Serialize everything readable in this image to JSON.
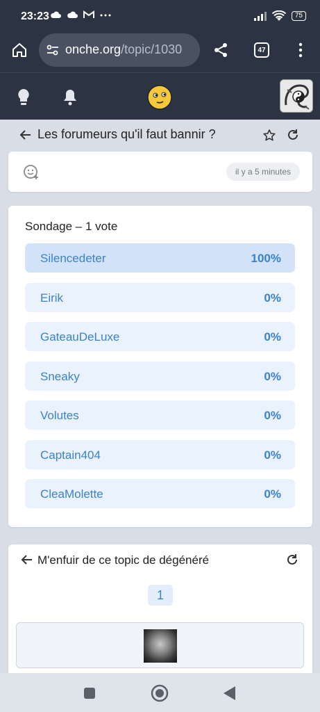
{
  "status_bar": {
    "time": "23:23",
    "notification_icons": [
      "cloud-icon",
      "cloud-icon",
      "gmail-icon",
      "more-dots-icon"
    ],
    "battery": "75"
  },
  "browser": {
    "url_domain": "onche.org",
    "url_path": "/topic/1030",
    "tab_count": "47"
  },
  "topic": {
    "title": "Les forumeurs qu'il faut bannir ?",
    "post_time": "il y a 5 minutes"
  },
  "poll": {
    "title": "Sondage – 1 vote",
    "options": [
      {
        "name": "Silencedeter",
        "percent": "100%",
        "selected": true
      },
      {
        "name": "Eirik",
        "percent": "0%"
      },
      {
        "name": "GateauDeLuxe",
        "percent": "0%"
      },
      {
        "name": "Sneaky",
        "percent": "0%"
      },
      {
        "name": "Volutes",
        "percent": "0%"
      },
      {
        "name": "Captain404",
        "percent": "0%"
      },
      {
        "name": "CleaMolette",
        "percent": "0%"
      }
    ]
  },
  "footer_nav": {
    "back_label": "M'enfuir de ce topic de dégénéré",
    "current_page": "1"
  },
  "colors": {
    "header_bg": "#2c3444",
    "option_text": "#3c82c6",
    "option_bg": "#eaf2fd",
    "option_selected_bg": "#d2e3f9"
  }
}
